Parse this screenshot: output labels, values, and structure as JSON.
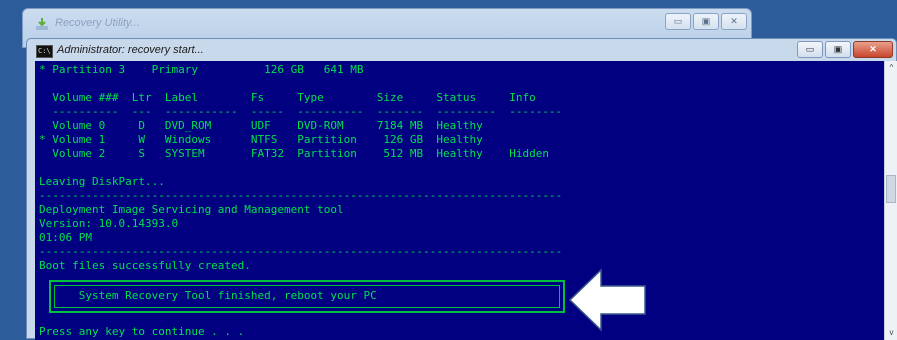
{
  "background_window": {
    "title": "Recovery Utility...",
    "icon": "recovery-utility-icon",
    "controls": {
      "minimize": "▭",
      "maximize": "▣",
      "close": "✕"
    }
  },
  "console": {
    "title": "Administrator: recovery start...",
    "icon": "cmd-icon",
    "controls": {
      "minimize": "▭",
      "maximize": "▣",
      "close": "✕"
    },
    "text_color": "#00e050",
    "background_color": "#000080",
    "lines": [
      "* Partition 3    Primary          126 GB   641 MB",
      "",
      "  Volume ###  Ltr  Label        Fs     Type        Size     Status     Info",
      "  ----------  ---  -----------  -----  ----------  -------  ---------  --------",
      "  Volume 0     D   DVD_ROM      UDF    DVD-ROM     7184 MB  Healthy",
      "* Volume 1     W   Windows      NTFS   Partition    126 GB  Healthy",
      "  Volume 2     S   SYSTEM       FAT32  Partition    512 MB  Healthy    Hidden",
      "",
      "Leaving DiskPart...",
      "-------------------------------------------------------------------------------",
      "Deployment Image Servicing and Management tool",
      "Version: 10.0.14393.0",
      "01:06 PM",
      "-------------------------------------------------------------------------------",
      "Boot files successfully created.",
      "",
      "      System Recovery Tool finished, reboot your PC",
      "",
      "",
      "Press any key to continue . . ."
    ],
    "scroll": {
      "up": "^",
      "down": "v"
    }
  },
  "annotation": {
    "arrow_icon": "left-arrow-icon",
    "arrow_color": "#ffffff"
  }
}
